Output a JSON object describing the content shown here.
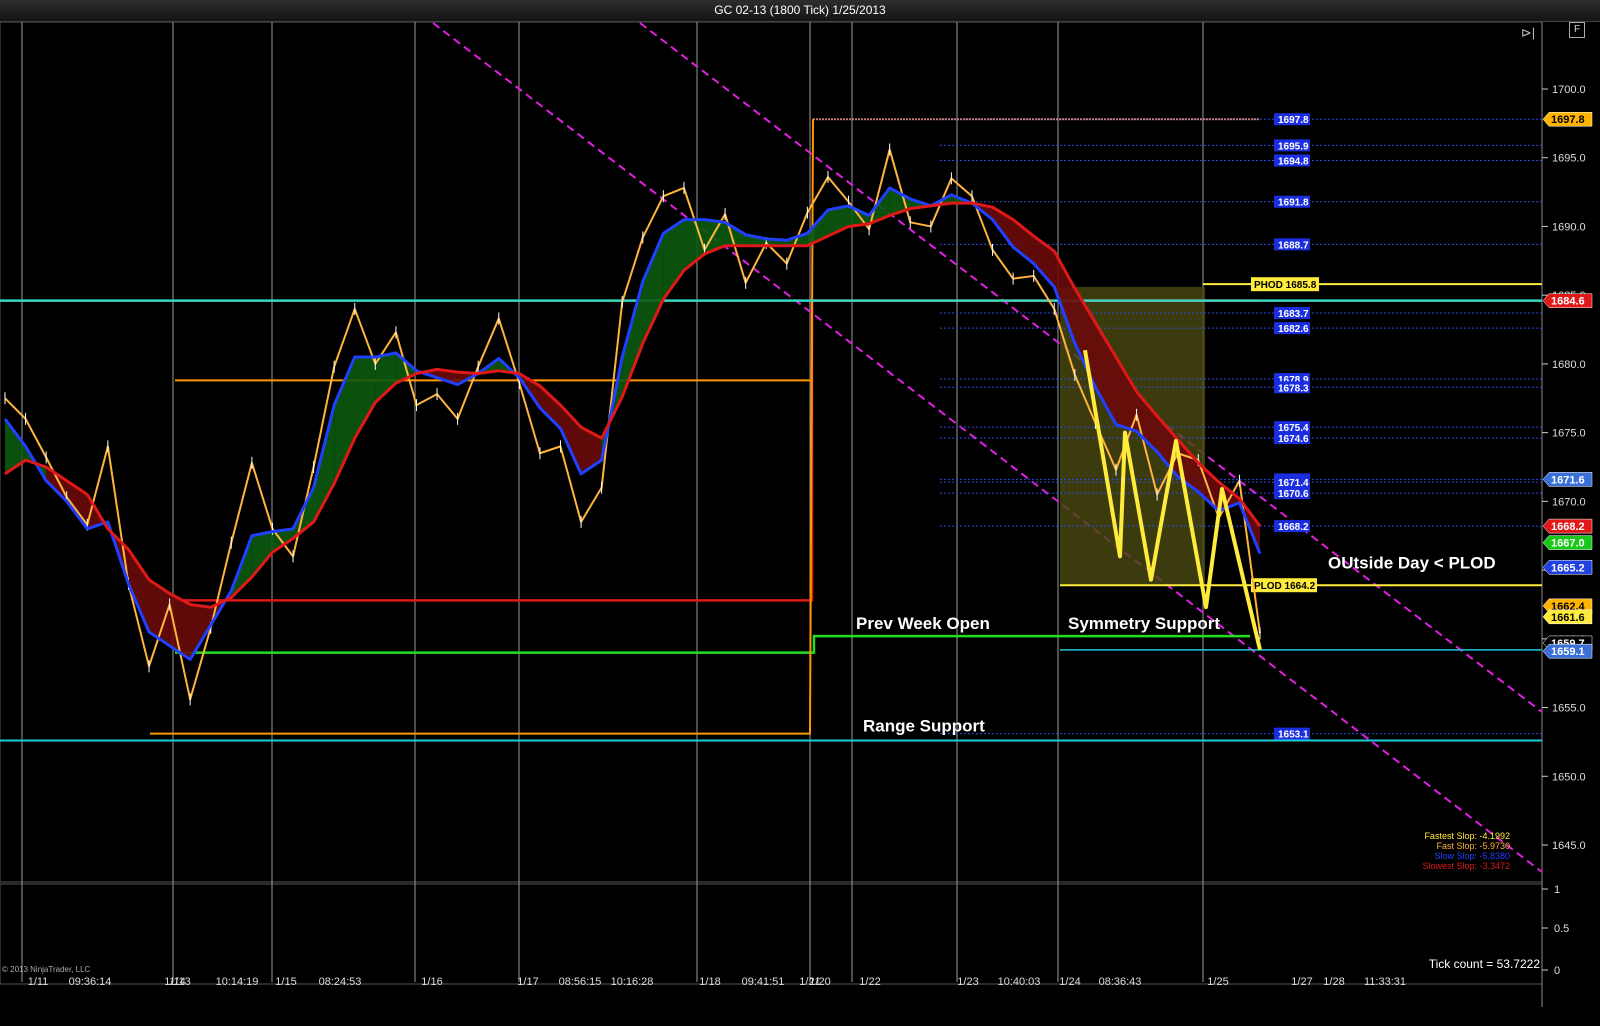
{
  "window": {
    "title": "GC 02-13 (1800 Tick)  1/25/2013"
  },
  "chart_data": {
    "type": "line",
    "title": "GC 02-13 (1800 Tick)  1/25/2013",
    "ylim": [
      1641,
      1702
    ],
    "yticks": [
      1700.0,
      1695.0,
      1690.0,
      1685.0,
      1680.0,
      1675.0,
      1670.0,
      1665.0,
      1660.0,
      1655.0,
      1650.0,
      1645.0
    ],
    "xtick_labels": [
      "1/11",
      "09:36:14",
      "1/14",
      "1/13",
      "10:14:19",
      "1/15",
      "08:24:53",
      "1/16",
      "1/17",
      "08:56:15",
      "10:16:28",
      "1/18",
      "09:41:51",
      "1/21",
      "1/20",
      "1/22",
      "1/23",
      "10:40:03",
      "1/24",
      "08:36:43",
      "1/25",
      "1/27",
      "1/28",
      "11:33:31"
    ],
    "price_series": [
      {
        "name": "price",
        "color": "#ffb43c",
        "values": [
          1677.5,
          1676,
          1673.2,
          1670.3,
          1668.3,
          1674,
          1664,
          1658,
          1662.5,
          1655.6,
          1660.8,
          1667,
          1672.8,
          1668,
          1666,
          1672.5,
          1679.8,
          1684,
          1680,
          1682.3,
          1677,
          1677.8,
          1676,
          1679.8,
          1683.3,
          1678.6,
          1673.5,
          1674,
          1668.5,
          1671,
          1684.5,
          1689.2,
          1692.2,
          1692.8,
          1688.3,
          1690.9,
          1685.9,
          1688.8,
          1687.3,
          1691,
          1693.6,
          1691.8,
          1689.8,
          1695.6,
          1690.3,
          1690,
          1693.5,
          1692.2,
          1688.3,
          1686.2,
          1686.4,
          1684,
          1679.2,
          1675.7,
          1672.3,
          1676.3,
          1670.5,
          1673.5,
          1673,
          1668.8,
          1671.5,
          1660.4
        ]
      },
      {
        "name": "fast-ema",
        "color": "#2040ff",
        "values": [
          1676,
          1674,
          1671.5,
          1670,
          1668,
          1668.5,
          1664,
          1660.5,
          1659.5,
          1658.5,
          1661,
          1663.5,
          1667.5,
          1667.8,
          1668,
          1671,
          1677,
          1680.5,
          1680.5,
          1680.8,
          1679.5,
          1679,
          1678.5,
          1679.3,
          1680.4,
          1679,
          1676.8,
          1675.3,
          1672,
          1673,
          1680.5,
          1686,
          1689.5,
          1690.5,
          1690.5,
          1690.3,
          1689.4,
          1689.1,
          1689,
          1689.5,
          1691.2,
          1691.5,
          1690.8,
          1692.8,
          1692,
          1691.5,
          1692.3,
          1691.7,
          1690.5,
          1688.5,
          1687.3,
          1685.6,
          1681.5,
          1678.3,
          1675.6,
          1675.1,
          1673.6,
          1671.8,
          1670.7,
          1669.3,
          1669.9,
          1666.2
        ]
      },
      {
        "name": "slow-ema",
        "color": "#e01818",
        "values": [
          1672,
          1673,
          1672.5,
          1671.5,
          1670.5,
          1668,
          1666.5,
          1664.3,
          1663.3,
          1662.5,
          1662.3,
          1663,
          1664.5,
          1666.3,
          1667.3,
          1668.5,
          1671.3,
          1674.6,
          1677.2,
          1678.6,
          1679.3,
          1679.6,
          1679.4,
          1679.3,
          1679.5,
          1679.3,
          1678.4,
          1677,
          1675.4,
          1674.6,
          1677.6,
          1681.5,
          1684.7,
          1686.8,
          1688,
          1688.6,
          1688.6,
          1688.6,
          1688.6,
          1688.6,
          1689.3,
          1690,
          1690.2,
          1690.8,
          1691.3,
          1691.5,
          1691.7,
          1691.7,
          1691.4,
          1690.5,
          1689.3,
          1688.2,
          1685.5,
          1683,
          1680.5,
          1678,
          1676.2,
          1674.5,
          1672.8,
          1671.4,
          1670.2,
          1668.2
        ]
      }
    ],
    "horizontal_levels": [
      {
        "value": 1684.6,
        "color": "#3ad7c0",
        "label": "1684.6",
        "label_color": "#e01818"
      },
      {
        "value": 1652.6,
        "color": "#1ecad8",
        "label": ""
      },
      {
        "value": 1663.9,
        "color": "#ffeb3b",
        "label": "1664.2"
      },
      {
        "value": 1685.8,
        "color": "#ffeb3b",
        "label": "1685.8"
      }
    ],
    "blue_level_labels": [
      "1697.8",
      "1695.9",
      "1694.8",
      "1691.8",
      "1688.7",
      "1683.7",
      "1682.6",
      "1678.9",
      "1678.3",
      "1675.4",
      "1674.6",
      "1671.6",
      "1671.4",
      "1670.6",
      "1668.2",
      "1653.1"
    ],
    "axis_price_labels": [
      {
        "value": 1697.8,
        "text": "1697.8",
        "bg": "#ffb400",
        "fg": "#000"
      },
      {
        "value": 1684.6,
        "text": "1684.6",
        "bg": "#e01818",
        "fg": "#fff"
      },
      {
        "value": 1671.6,
        "text": "1671.6",
        "bg": "#3a6fd8",
        "fg": "#fff"
      },
      {
        "value": 1668.2,
        "text": "1668.2",
        "bg": "#e01818",
        "fg": "#fff"
      },
      {
        "value": 1667.0,
        "text": "1667.0",
        "bg": "#18c818",
        "fg": "#fff"
      },
      {
        "value": 1665.2,
        "text": "1665.2",
        "bg": "#2040e0",
        "fg": "#fff"
      },
      {
        "value": 1662.4,
        "text": "1662.4",
        "bg": "#ffb400",
        "fg": "#000"
      },
      {
        "value": 1661.6,
        "text": "1661.6",
        "bg": "#ffeb3b",
        "fg": "#000"
      },
      {
        "value": 1659.7,
        "text": "1659.7",
        "bg": "#000",
        "fg": "#fff"
      },
      {
        "value": 1659.1,
        "text": "1659.1",
        "bg": "#3a6fd8",
        "fg": "#fff"
      }
    ],
    "annotations": [
      "PHOD",
      "PLOD",
      "OUtside Day < PLOD",
      "Prev Week Open",
      "Symmetry Support",
      "Range Support"
    ],
    "lower_panel": {
      "yticks": [
        "1",
        "0.5",
        "0"
      ],
      "tick_count": "Tick count = 53.7222"
    },
    "slope_readouts": [
      {
        "text": "Fastest Slop: -4.1992",
        "color": "#ffeb3b"
      },
      {
        "text": "Fast Slop: -5.9730",
        "color": "#ffb43c"
      },
      {
        "text": "Slow Slop: -5.8380",
        "color": "#2040ff"
      },
      {
        "text": "Slowest Slop: -3.3472",
        "color": "#e01818"
      }
    ]
  },
  "footer": {
    "copyright": "© 2013 NinjaTrader, LLC"
  },
  "controls": {
    "format_label": "F",
    "play_icon": "⊳|"
  }
}
